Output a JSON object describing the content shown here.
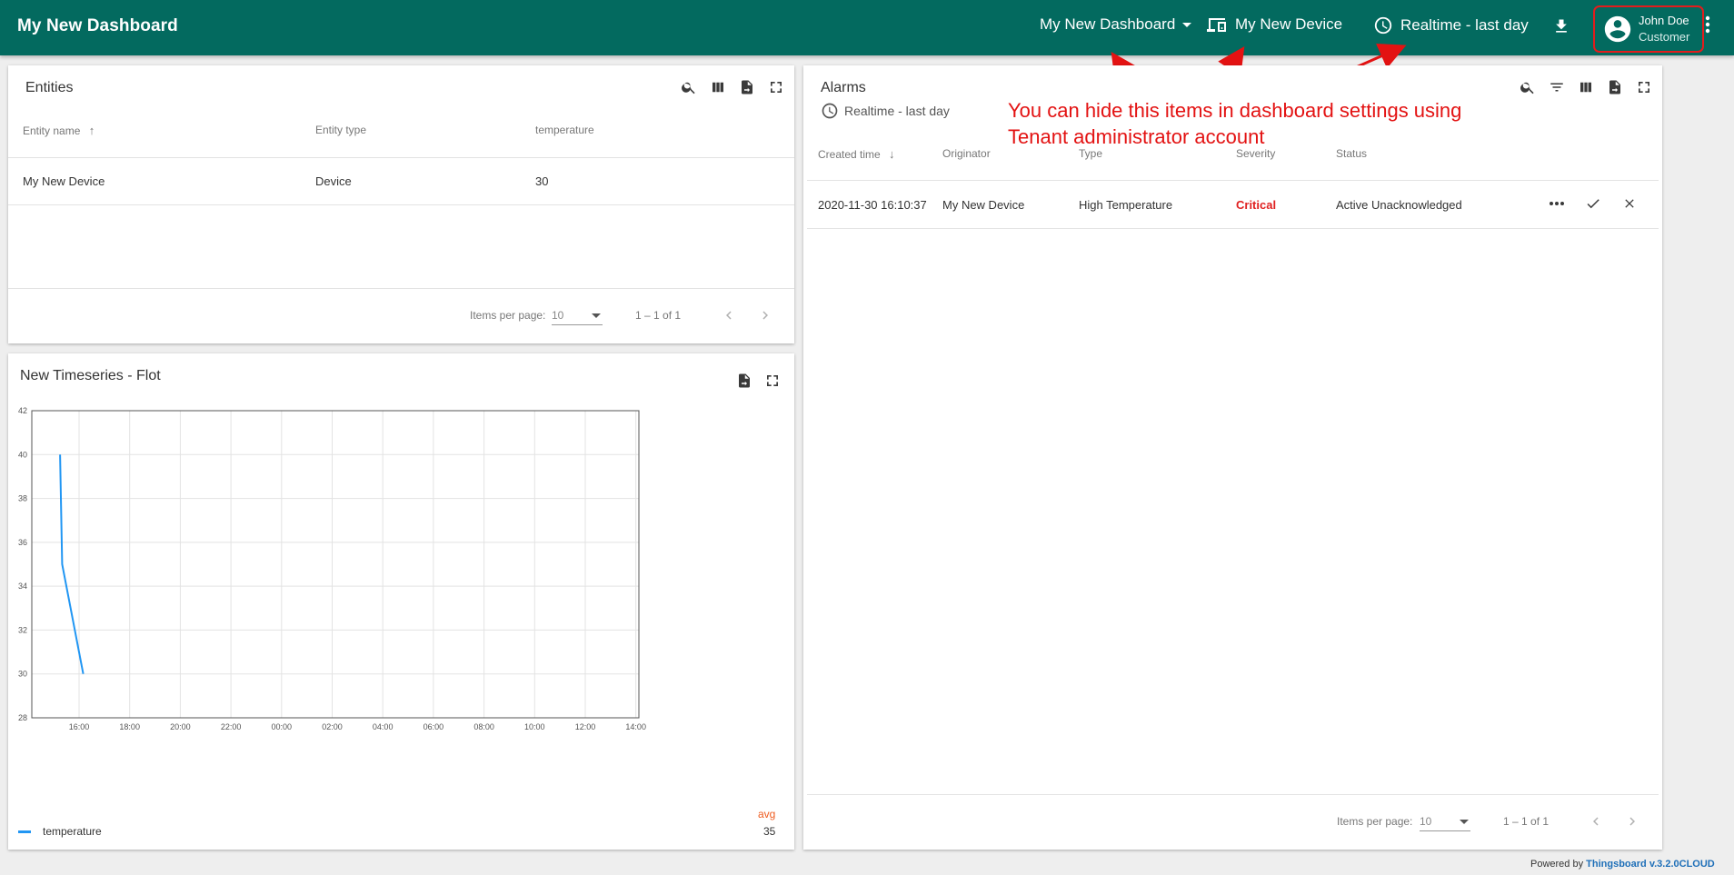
{
  "topbar": {
    "title": "My New Dashboard",
    "dashboard_select": "My New Dashboard",
    "entity_alias": "My New Device",
    "timewindow": "Realtime - last day",
    "user_name": "John Doe",
    "user_role": "Customer",
    "bg_color": "#036a5f"
  },
  "annotation": {
    "line1": "You can hide this items in dashboard settings using",
    "line2": "Tenant administrator account",
    "color": "#e31212"
  },
  "entities": {
    "title": "Entities",
    "columns": [
      "Entity name",
      "Entity type",
      "temperature"
    ],
    "rows": [
      {
        "name": "My New Device",
        "type": "Device",
        "temperature": "30"
      }
    ],
    "pager": {
      "items_per_page_label": "Items per page:",
      "page_size": "10",
      "range": "1 – 1 of 1"
    }
  },
  "alarms": {
    "title": "Alarms",
    "timewindow": "Realtime - last day",
    "columns": [
      "Created time",
      "Originator",
      "Type",
      "Severity",
      "Status"
    ],
    "rows": [
      {
        "created": "2020-11-30 16:10:37",
        "originator": "My New Device",
        "type": "High Temperature",
        "severity": "Critical",
        "status": "Active Unacknowledged"
      }
    ],
    "pager": {
      "items_per_page_label": "Items per page:",
      "page_size": "10",
      "range": "1 – 1 of 1"
    }
  },
  "timeseries": {
    "title": "New Timeseries - Flot",
    "legend_header": "avg",
    "legend_series": "temperature",
    "legend_avg": "35"
  },
  "chart_data": {
    "type": "line",
    "title": "New Timeseries - Flot",
    "xlabel": "",
    "ylabel": "",
    "ylim": [
      28,
      42
    ],
    "y_ticks": [
      "28",
      "30",
      "32",
      "34",
      "36",
      "38",
      "40",
      "42"
    ],
    "x_ticks": [
      "16:00",
      "18:00",
      "20:00",
      "22:00",
      "00:00",
      "02:00",
      "04:00",
      "06:00",
      "08:00",
      "10:00",
      "12:00",
      "14:00"
    ],
    "grid": true,
    "legend": "bottom-left",
    "series": [
      {
        "name": "temperature",
        "color": "#2196f3",
        "x": [
          "15:15",
          "15:20",
          "16:10"
        ],
        "values": [
          40,
          35,
          30
        ]
      }
    ]
  },
  "footer": {
    "powered_by": "Powered by",
    "link": "Thingsboard v.3.2.0CLOUD"
  }
}
